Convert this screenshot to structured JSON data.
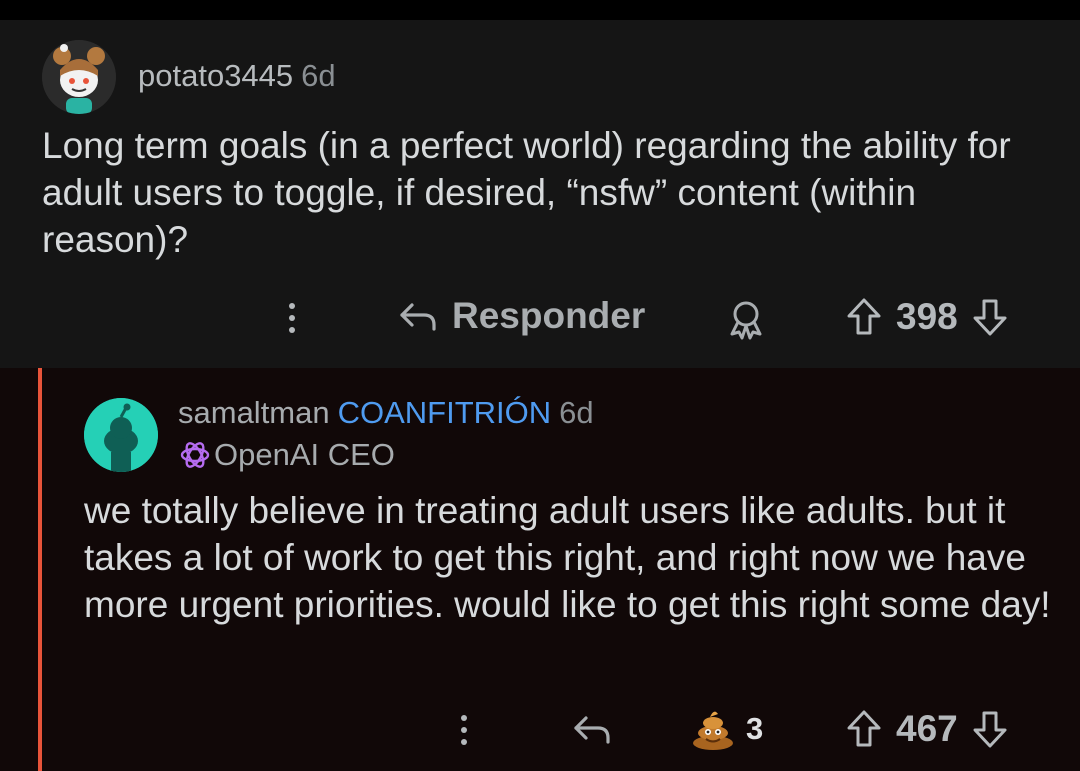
{
  "parent_comment": {
    "username": "potato3445",
    "age": "6d",
    "body": "Long term goals (in a perfect world) regarding the ability for adult users to toggle, if desired, “nsfw” content (within reason)?",
    "actions": {
      "reply_label": "Responder",
      "score": "398"
    }
  },
  "reply_comment": {
    "username": "samaltman",
    "host_badge": "COANFITRIÓN",
    "age": "6d",
    "flair": "OpenAI CEO",
    "body": "we totally believe in treating adult users like adults. but it takes a lot of work to get this right, and right now we have more urgent priorities. would like to get this right some day!",
    "actions": {
      "award_count": "3",
      "score": "467"
    }
  },
  "colors": {
    "thread_line": "#e8543a",
    "host_badge": "#4f9bf0",
    "reply_background": "#110808",
    "parent_background": "#151515"
  },
  "icons": {
    "more": "more-vertical-icon",
    "reply": "reply-arrow-icon",
    "award": "award-ribbon-icon",
    "upvote": "upvote-arrow-icon",
    "downvote": "downvote-arrow-icon",
    "openai": "openai-logo-icon",
    "poop_award": "poop-award-icon"
  }
}
